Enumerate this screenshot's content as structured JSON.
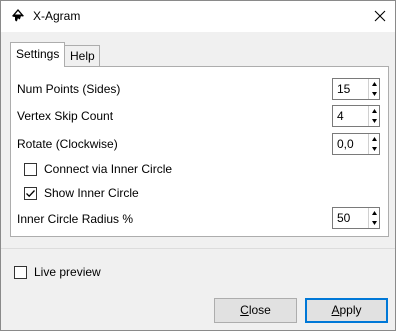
{
  "window": {
    "title": "X-Agram"
  },
  "tabs": [
    {
      "label": "Settings",
      "active": true
    },
    {
      "label": "Help",
      "active": false
    }
  ],
  "settings": {
    "num_points": {
      "label": "Num Points (Sides)",
      "value": "15"
    },
    "vertex_skip": {
      "label": "Vertex Skip Count",
      "value": "4"
    },
    "rotate": {
      "label": "Rotate (Clockwise)",
      "value": "0,0"
    },
    "connect_inner": {
      "label": "Connect via Inner Circle",
      "checked": false
    },
    "show_inner": {
      "label": "Show Inner Circle",
      "checked": true
    },
    "inner_radius": {
      "label": "Inner Circle Radius %",
      "value": "50"
    }
  },
  "live_preview": {
    "label": "Live preview",
    "checked": false
  },
  "buttons": {
    "close_first": "C",
    "close_rest": "lose",
    "apply_first": "A",
    "apply_rest": "pply"
  },
  "colors": {
    "accent": "#0078d7"
  }
}
